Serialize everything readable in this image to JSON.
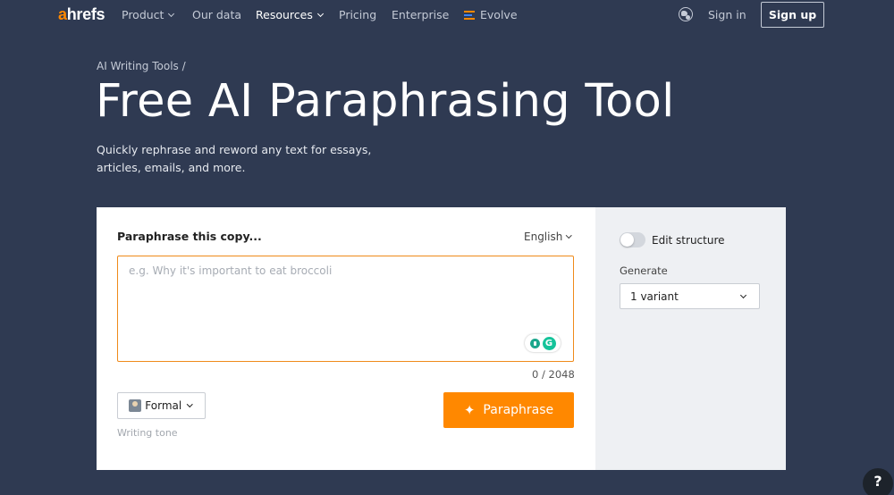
{
  "brand": {
    "logo_first": "a",
    "logo_rest": "hrefs",
    "accent": "#ff8800"
  },
  "nav": {
    "items": [
      {
        "label": "Product",
        "has_dropdown": true
      },
      {
        "label": "Our data",
        "has_dropdown": false
      },
      {
        "label": "Resources",
        "has_dropdown": true
      },
      {
        "label": "Pricing",
        "has_dropdown": false
      },
      {
        "label": "Enterprise",
        "has_dropdown": false
      },
      {
        "label": "Evolve",
        "has_dropdown": false,
        "icon": "evolve-logo-icon"
      }
    ],
    "globe_icon": "globe-icon",
    "signin_label": "Sign in",
    "signup_label": "Sign up"
  },
  "hero": {
    "breadcrumb": "AI Writing Tools /",
    "title": "Free AI Paraphrasing Tool",
    "subtitle": "Quickly rephrase and reword any text for essays, articles, emails, and more."
  },
  "tool": {
    "input_label": "Paraphrase this copy...",
    "language": "English",
    "placeholder": "e.g. Why it's important to eat broccoli",
    "counter": "0 / 2048",
    "tone": "Formal",
    "tone_hint": "Writing tone",
    "paraphrase_label": "Paraphrase",
    "sparkle_icon": "sparkle-icon"
  },
  "side": {
    "toggle_label": "Edit structure",
    "toggle_on": false,
    "generate_label": "Generate",
    "generate_value": "1 variant"
  },
  "help": {
    "label": "?"
  },
  "colors": {
    "background": "#2f3a52",
    "primary_button": "#ff8800",
    "textarea_border": "#ef8a1a",
    "side_panel": "#eef0f3"
  }
}
